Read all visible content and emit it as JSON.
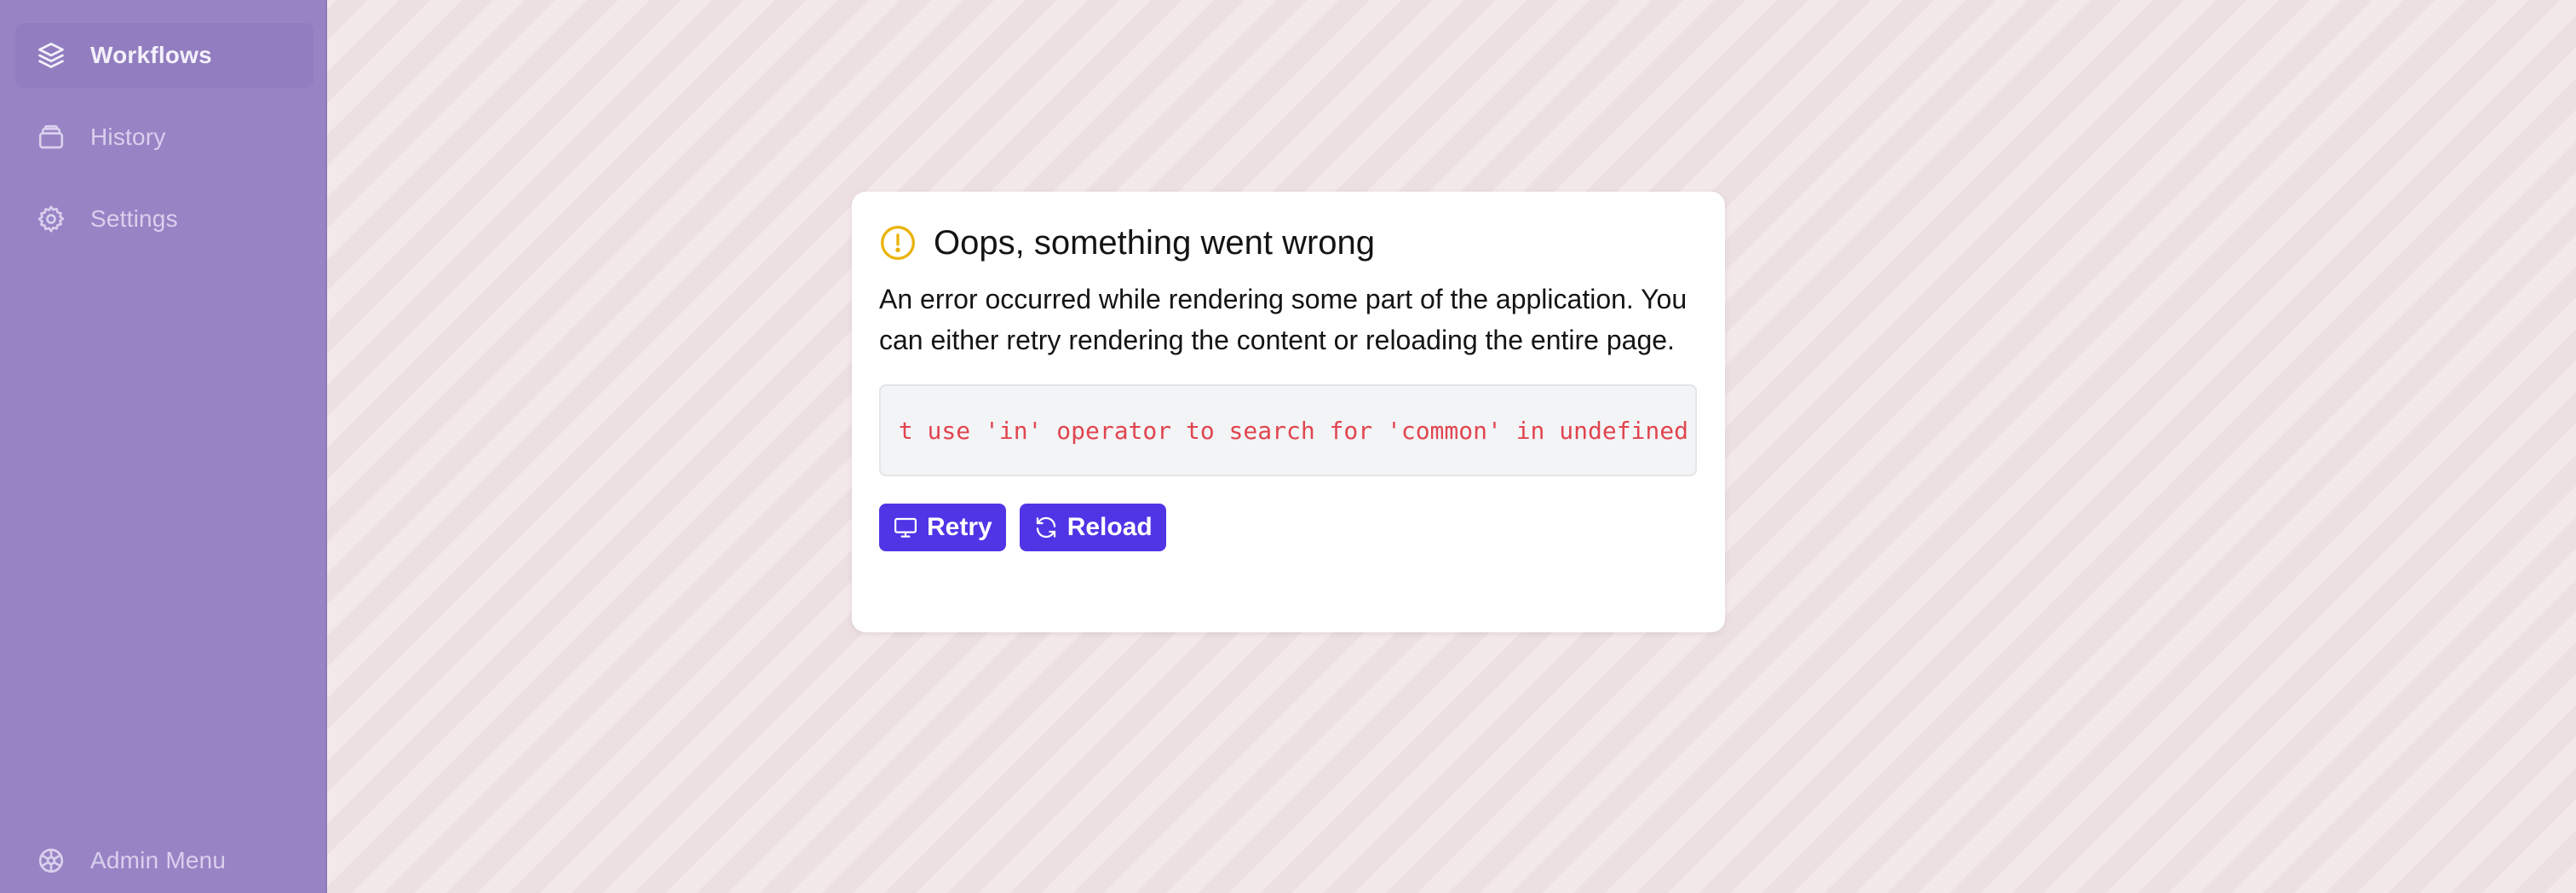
{
  "sidebar": {
    "items": [
      {
        "label": "Workflows",
        "icon": "layers-icon",
        "active": true
      },
      {
        "label": "History",
        "icon": "archive-icon",
        "active": false
      },
      {
        "label": "Settings",
        "icon": "gear-icon",
        "active": false
      }
    ],
    "footer": {
      "label": "Admin Menu",
      "icon": "admin-gear-icon"
    }
  },
  "error_card": {
    "title": "Oops, something went wrong",
    "message": "An error occurred while rendering some part of the application. You can either retry rendering the content or reloading the entire page.",
    "error_detail": "t use 'in' operator to search for 'common' in undefined",
    "retry_label": "Retry",
    "reload_label": "Reload"
  },
  "colors": {
    "sidebar_bg": "#9883c4",
    "accent": "#4f35e6",
    "warning": "#eab308",
    "error_text": "#e0454f",
    "background_stripes": [
      "#f4e9ea",
      "#ede0e2"
    ]
  }
}
